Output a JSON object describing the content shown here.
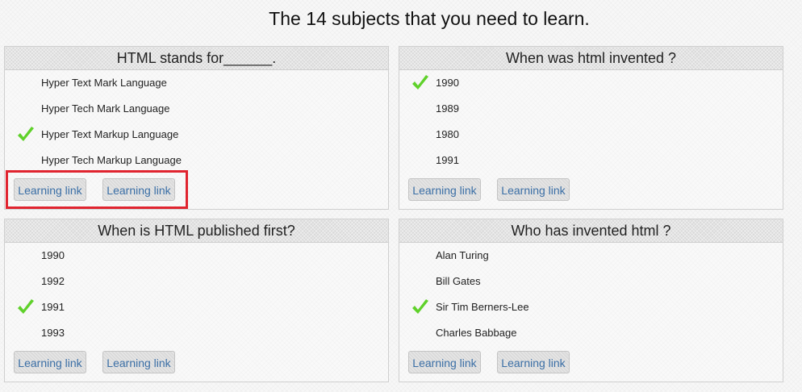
{
  "page": {
    "title": "The 14 subjects that you need to learn."
  },
  "questions": [
    {
      "title": "HTML stands for______.",
      "options": [
        {
          "label": "Hyper Text Mark Language",
          "checked": false
        },
        {
          "label": "Hyper Tech Mark Language",
          "checked": false
        },
        {
          "label": "Hyper Text Markup Language",
          "checked": true
        },
        {
          "label": "Hyper Tech Markup Language",
          "checked": false
        }
      ],
      "links": [
        "Learning link",
        "Learning link"
      ]
    },
    {
      "title": "When was html invented ?",
      "options": [
        {
          "label": "1990",
          "checked": true
        },
        {
          "label": "1989",
          "checked": false
        },
        {
          "label": "1980",
          "checked": false
        },
        {
          "label": "1991",
          "checked": false
        }
      ],
      "links": [
        "Learning link",
        "Learning link"
      ]
    },
    {
      "title": "When is HTML published first?",
      "options": [
        {
          "label": "1990",
          "checked": false
        },
        {
          "label": "1992",
          "checked": false
        },
        {
          "label": "1991",
          "checked": true
        },
        {
          "label": "1993",
          "checked": false
        }
      ],
      "links": [
        "Learning link",
        "Learning link"
      ]
    },
    {
      "title": "Who has invented html ?",
      "options": [
        {
          "label": "Alan Turing",
          "checked": false
        },
        {
          "label": "Bill Gates",
          "checked": false
        },
        {
          "label": "Sir Tim Berners-Lee",
          "checked": true
        },
        {
          "label": "Charles Babbage",
          "checked": false
        }
      ],
      "links": [
        "Learning link",
        "Learning link"
      ]
    }
  ],
  "icons": {
    "check": "checkmark-icon"
  },
  "colors": {
    "check": "#5fd12a",
    "link": "#3b6fa6",
    "highlight": "#e0242f"
  }
}
